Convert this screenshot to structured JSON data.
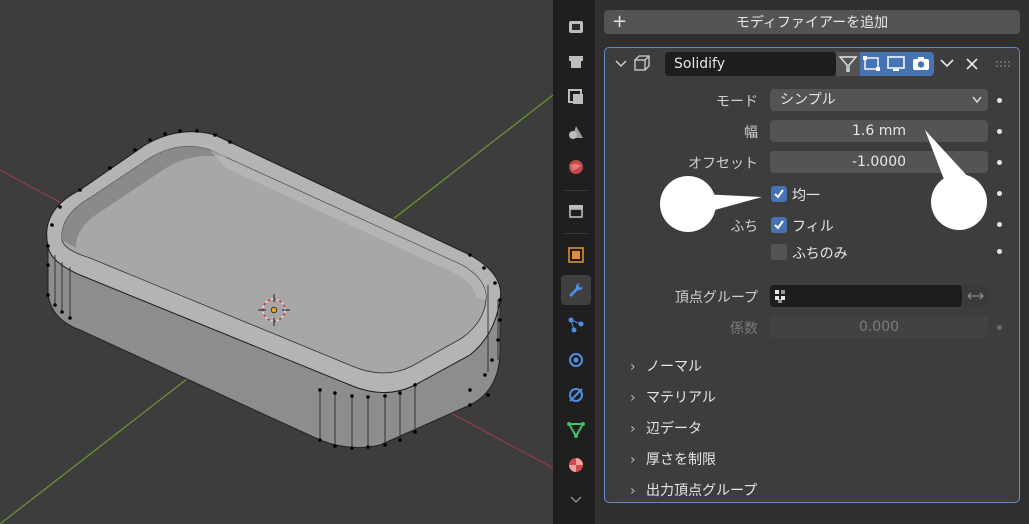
{
  "modifier_panel": {
    "add_modifier_label": "モディファイアーを追加",
    "modifier_name": "Solidify",
    "fields": {
      "mode_label": "モード",
      "mode_value": "シンプル",
      "thickness_label": "幅",
      "thickness_value": "1.6 mm",
      "offset_label": "オフセット",
      "offset_value": "-1.0000",
      "even_thickness_label": "均一",
      "rim_label": "ふち",
      "rim_fill_label": "フィル",
      "rim_only_label": "ふちのみ",
      "vertex_group_label": "頂点グループ",
      "factor_label": "係数",
      "factor_value": "0.000"
    },
    "subpanels": [
      "ノーマル",
      "マテリアル",
      "辺データ",
      "厚さを制限",
      "出力頂点グループ"
    ]
  },
  "colors": {
    "accent_blue": "#4772b3",
    "viewport_bg": "#3d3d3d",
    "panel_bg": "#303030",
    "x_axis": "#a13a3a",
    "y_axis": "#6d9a2e"
  },
  "icons": [
    "tool-icon",
    "render-icon",
    "output-icon",
    "view-layer-icon",
    "scene-icon",
    "world-icon",
    "collection-icon",
    "object-icon",
    "modifier-wrench-icon",
    "particles-icon",
    "physics-icon",
    "constraints-icon",
    "data-icon",
    "material-icon"
  ]
}
